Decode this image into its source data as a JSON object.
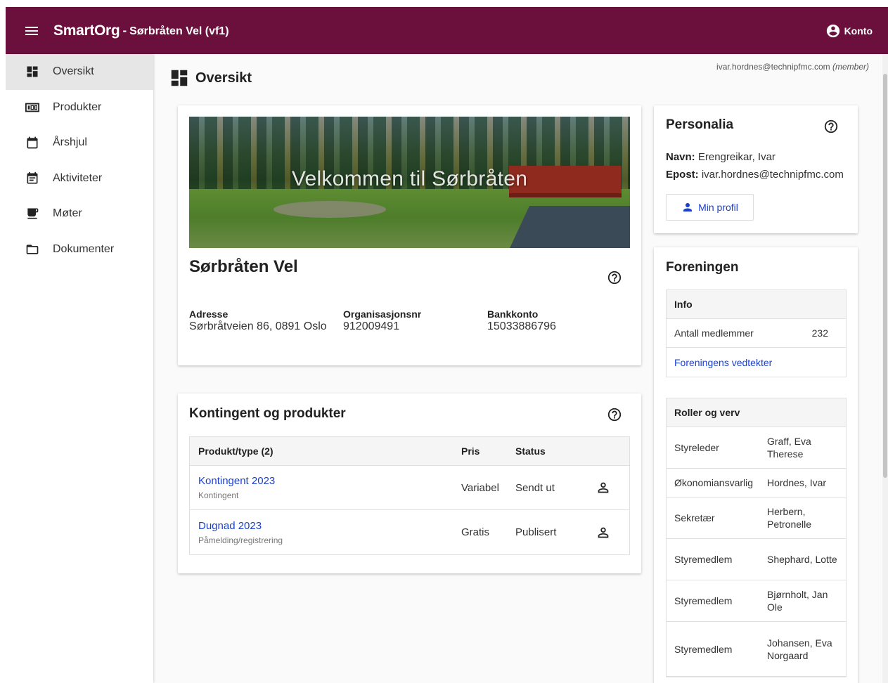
{
  "header": {
    "brand": "SmartOrg",
    "separator": "-",
    "org_title": "Sørbråten Vel (vf1)",
    "account_label": "Konto"
  },
  "sidebar": {
    "items": [
      {
        "label": "Oversikt",
        "icon": "dashboard-icon"
      },
      {
        "label": "Produkter",
        "icon": "products-icon"
      },
      {
        "label": "Årshjul",
        "icon": "calendar-icon"
      },
      {
        "label": "Aktiviteter",
        "icon": "event-note-icon"
      },
      {
        "label": "Møter",
        "icon": "coffee-icon"
      },
      {
        "label": "Dokumenter",
        "icon": "folder-icon"
      }
    ]
  },
  "page": {
    "title": "Oversikt",
    "user_email": "ivar.hordnes@technipfmc.com",
    "user_role": "(member)"
  },
  "org_card": {
    "banner_text": "Velkommen til Sørbråten",
    "name": "Sørbråten Vel",
    "address_label": "Adresse",
    "address": "Sørbråtveien 86, 0891 Oslo",
    "orgnr_label": "Organisasjonsnr",
    "orgnr": "912009491",
    "bank_label": "Bankkonto",
    "bank": "15033886796"
  },
  "products_card": {
    "title": "Kontingent og produkter",
    "columns": [
      "Produkt/type (2)",
      "Pris",
      "Status"
    ],
    "rows": [
      {
        "name": "Kontingent 2023",
        "type": "Kontingent",
        "price": "Variabel",
        "status": "Sendt ut"
      },
      {
        "name": "Dugnad 2023",
        "type": "Påmelding/registrering",
        "price": "Gratis",
        "status": "Publisert"
      }
    ]
  },
  "personalia": {
    "title": "Personalia",
    "name_label": "Navn:",
    "name": "Erengreikar, Ivar",
    "email_label": "Epost:",
    "email": "ivar.hordnes@technipfmc.com",
    "profile_button": "Min profil"
  },
  "foreningen": {
    "title": "Foreningen",
    "info_header": "Info",
    "members_label": "Antall medlemmer",
    "members_count": "232",
    "statutes_link": "Foreningens vedtekter",
    "roles_header": "Roller og verv",
    "roles": [
      {
        "role": "Styreleder",
        "name": "Graff, Eva Therese"
      },
      {
        "role": "Økonomiansvarlig",
        "name": "Hordnes, Ivar"
      },
      {
        "role": "Sekretær",
        "name": "Herbern, Petronelle"
      },
      {
        "role": "Styremedlem",
        "name": "Shephard, Lotte"
      },
      {
        "role": "Styremedlem",
        "name": "Bjørnholt, Jan Ole"
      },
      {
        "role": "Styremedlem",
        "name": "Johansen, Eva Norgaard"
      }
    ]
  },
  "colors": {
    "topbar": "#6b0f3d",
    "link": "#1a3fcf"
  }
}
